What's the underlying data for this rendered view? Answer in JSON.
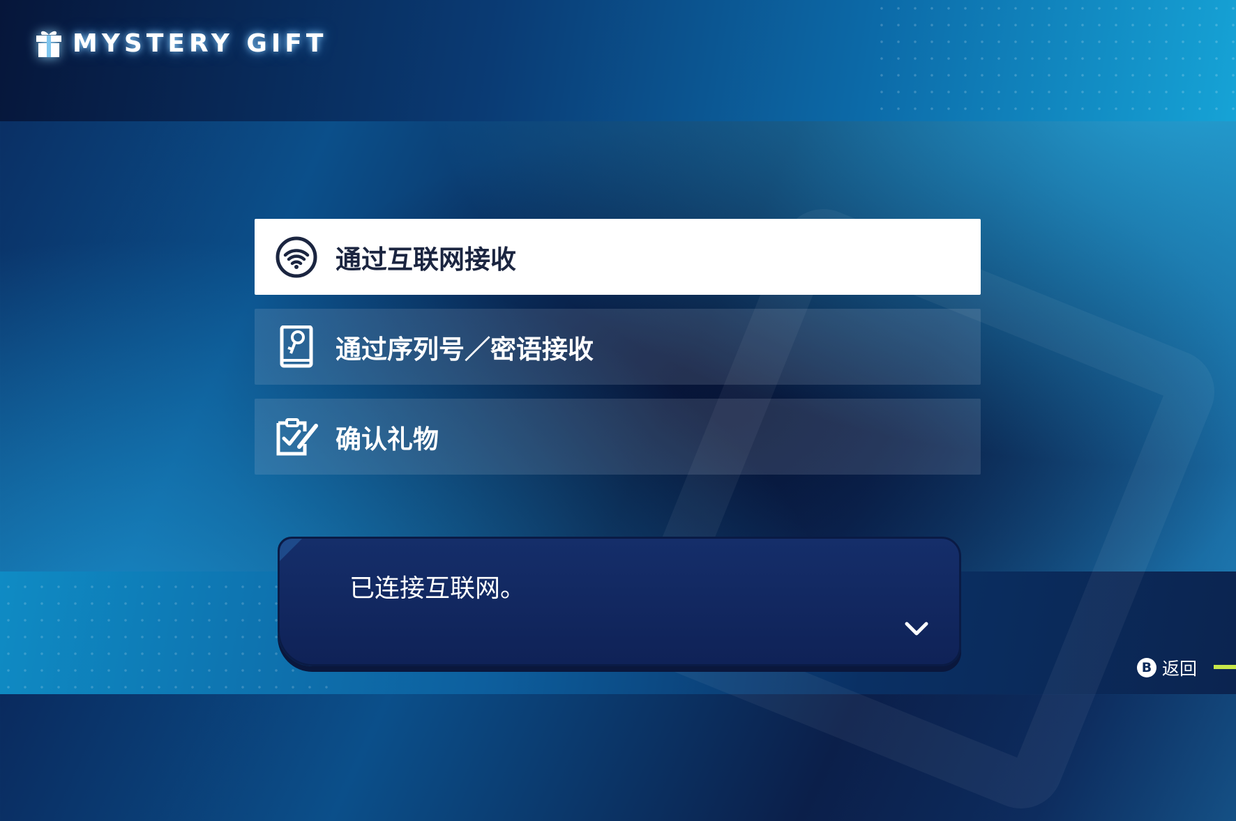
{
  "header": {
    "title": "MYSTERY GIFT",
    "icon": "gift-icon"
  },
  "menu": {
    "items": [
      {
        "label": "通过互联网接收",
        "icon": "wifi-icon",
        "selected": true
      },
      {
        "label": "通过序列号／密语接收",
        "icon": "key-document-icon",
        "selected": false
      },
      {
        "label": "确认礼物",
        "icon": "clipboard-check-icon",
        "selected": false
      }
    ]
  },
  "dialog": {
    "message": "已连接互联网。",
    "icon": "chevron-down-icon"
  },
  "footer": {
    "button": "B",
    "back_label": "返回"
  },
  "colors": {
    "selected_background": "#ffffff",
    "selected_text": "#1b2540",
    "dialog_background": "#152e6a",
    "accent": "#c9e84a"
  }
}
